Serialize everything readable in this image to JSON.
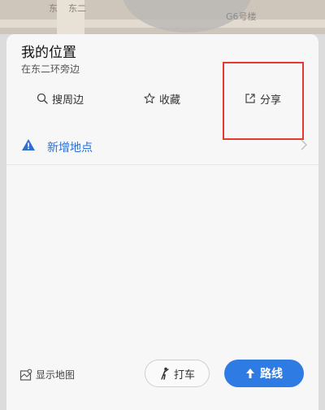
{
  "map": {
    "label_left_1": "东",
    "label_left_2": "东二",
    "label_right": "G6号楼"
  },
  "card": {
    "title": "我的位置",
    "subtitle": "在东二环旁边"
  },
  "actions": {
    "search_label": "搜周边",
    "favorite_label": "收藏",
    "share_label": "分享"
  },
  "add_place": {
    "label": "新增地点"
  },
  "bottom_bar": {
    "show_map_label": "显示地图",
    "taxi_label": "打车",
    "route_label": "路线"
  },
  "colors": {
    "accent": "#2f7be4",
    "link": "#2a6fd6",
    "highlight": "#e53935"
  }
}
